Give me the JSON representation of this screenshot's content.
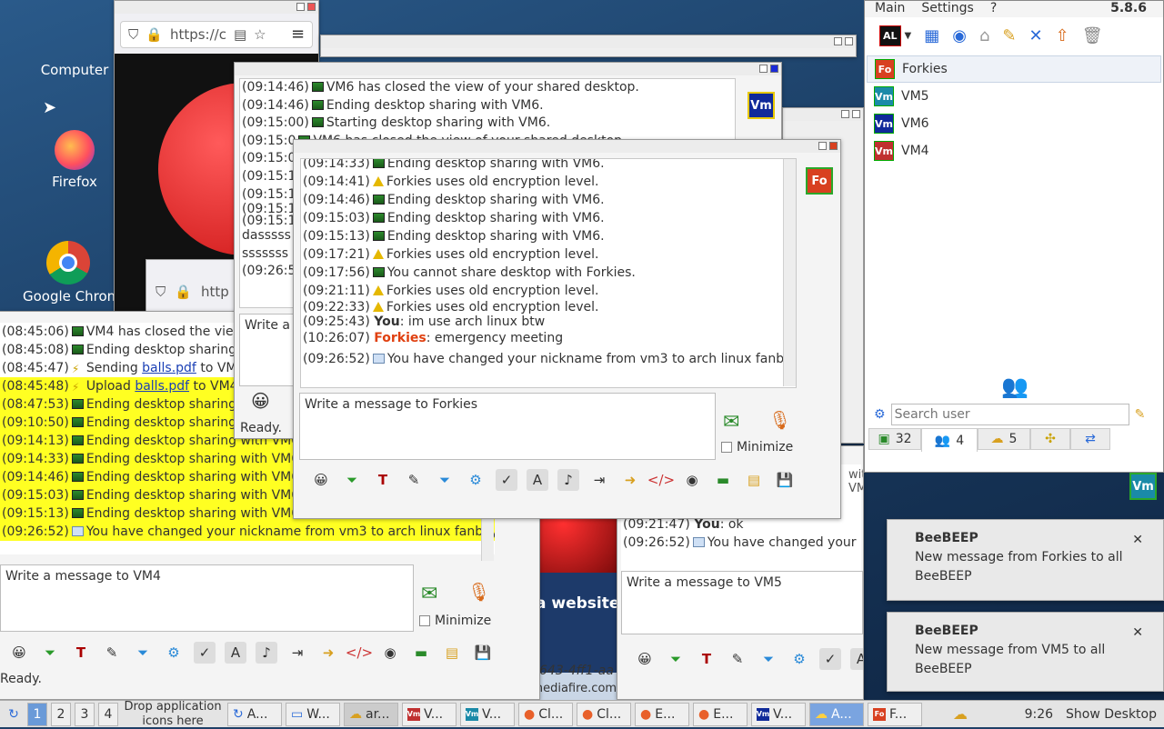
{
  "desktop": {
    "icons": [
      {
        "label": "Computer"
      },
      {
        "label": "Firefox"
      },
      {
        "label": "Google Chrome"
      }
    ]
  },
  "browser": {
    "url": "https://c",
    "url2": "http"
  },
  "vm4": {
    "log": [
      {
        "ts": "(08:45:06)",
        "icon": "sh",
        "text": "VM4 has closed the view"
      },
      {
        "ts": "(08:45:08)",
        "icon": "sh",
        "text": "Ending desktop sharing"
      },
      {
        "ts": "(08:45:47)",
        "icon": "up",
        "pre": "Sending ",
        "link": "balls.pdf",
        "text": " to VM4"
      },
      {
        "ts": "(08:45:48)",
        "icon": "up",
        "pre": "Upload ",
        "link": "balls.pdf",
        "text": " to VM4:",
        "hl": true
      },
      {
        "ts": "(08:47:53)",
        "icon": "sh",
        "text": "Ending desktop sharing",
        "hl": true
      },
      {
        "ts": "(09:10:50)",
        "icon": "sh",
        "text": "Ending desktop sharing",
        "hl": true
      },
      {
        "ts": "(09:14:13)",
        "icon": "sh",
        "text": "Ending desktop sharing with VM6.",
        "hl": true
      },
      {
        "ts": "(09:14:33)",
        "icon": "sh",
        "text": "Ending desktop sharing with VM6.",
        "hl": true
      },
      {
        "ts": "(09:14:46)",
        "icon": "sh",
        "text": "Ending desktop sharing with VM6.",
        "hl": true
      },
      {
        "ts": "(09:15:03)",
        "icon": "sh",
        "text": "Ending desktop sharing with VM6.",
        "hl": true
      },
      {
        "ts": "(09:15:13)",
        "icon": "sh",
        "text": "Ending desktop sharing with VM6.",
        "hl": true
      },
      {
        "ts": "(09:26:52)",
        "icon": "sy",
        "text": "You have changed your nickname from vm3 to arch linux fanboy.",
        "hl": true
      }
    ],
    "compose": "Write a message to VM4",
    "minimize": "Minimize",
    "status": "Ready."
  },
  "vm6": {
    "log": [
      {
        "ts": "(09:14:46)",
        "icon": "sh",
        "text": "VM6 has closed the view of your shared desktop."
      },
      {
        "ts": "(09:14:46)",
        "icon": "sh",
        "text": "Ending desktop sharing with VM6."
      },
      {
        "ts": "(09:15:00)",
        "icon": "sh",
        "text": "Starting desktop sharing with VM6."
      },
      {
        "ts": "(09:15:0",
        "icon": "sh",
        "text": "VM6 has closed the view of your shared desktop."
      },
      {
        "ts": "(09:15:0",
        "icon": "",
        "text": ""
      },
      {
        "ts": "(09:15:1",
        "icon": "",
        "text": ""
      },
      {
        "ts": "(09:15:1",
        "icon": "",
        "text": ""
      },
      {
        "ts": "(09:15:1",
        "icon": "",
        "text": ""
      },
      {
        "ts": "(09:15:1",
        "icon": "",
        "text": ""
      },
      {
        "ts": "dasssss",
        "icon": "",
        "text": ""
      },
      {
        "ts": "sssssss",
        "icon": "",
        "text": ""
      },
      {
        "ts": "(09:26:5",
        "icon": "",
        "text": ""
      }
    ],
    "compose": "Write a m",
    "status": "Ready.",
    "avatar": "Vm"
  },
  "forkies": {
    "log": [
      {
        "ts": "(09:14:33)",
        "icon": "sh",
        "text": "Ending desktop sharing with VM6."
      },
      {
        "ts": "(09:14:41)",
        "icon": "wn",
        "text": "Forkies uses old encryption level."
      },
      {
        "ts": "(09:14:46)",
        "icon": "sh",
        "text": "Ending desktop sharing with VM6."
      },
      {
        "ts": "(09:15:03)",
        "icon": "sh",
        "text": "Ending desktop sharing with VM6."
      },
      {
        "ts": "(09:15:13)",
        "icon": "sh",
        "text": "Ending desktop sharing with VM6."
      },
      {
        "ts": "(09:17:21)",
        "icon": "wn",
        "text": "Forkies uses old encryption level."
      },
      {
        "ts": "(09:17:56)",
        "icon": "sh",
        "text": "You cannot share desktop with Forkies."
      },
      {
        "ts": "(09:21:11)",
        "icon": "wn",
        "text": "Forkies uses old encryption level."
      },
      {
        "ts": "(09:22:33)",
        "icon": "wn",
        "text": "Forkies uses old encryption level."
      }
    ],
    "msg1": {
      "ts": "(09:25:43)",
      "who": "You",
      "text": ": im use arch linux btw"
    },
    "msg2": {
      "ts": "(10:26:07)",
      "who": "Forkies",
      "text": ": emergency meeting"
    },
    "sys": {
      "ts": "(09:26:52)",
      "text": "You have changed your nickname from vm3 to arch linux fanboy."
    },
    "compose": "Write a message to Forkies",
    "minimize": "Minimize",
    "avatar": "Fo"
  },
  "vm5": {
    "log1": {
      "ts": "(09:21:47)",
      "who": "You",
      "text": ": ok"
    },
    "log2": {
      "ts": "(09:26:52)",
      "text": "You have changed your nickn"
    },
    "partial": "with VM6.",
    "compose": "Write a message to VM5",
    "avatar": "Vm"
  },
  "web": {
    "heading": "a website",
    "url": "643-4ff1-aa",
    "url2": "https://www.mediafire.com%2"
  },
  "beebeep": {
    "menu": [
      "Main",
      "Settings",
      "?"
    ],
    "version": "5.8.6",
    "al": "AL",
    "users": [
      {
        "name": "Forkies",
        "av": "Fo",
        "color": "#d84020"
      },
      {
        "name": "VM5",
        "av": "Vm",
        "color": "#1a8aa8"
      },
      {
        "name": "VM6",
        "av": "Vm",
        "color": "#102a9a"
      },
      {
        "name": "VM4",
        "av": "Vm",
        "color": "#c03030"
      }
    ],
    "search_placeholder": "Search user",
    "tabs": [
      {
        "count": "32"
      },
      {
        "count": "4"
      },
      {
        "count": "5"
      },
      {
        "count": ""
      },
      {
        "count": ""
      }
    ]
  },
  "notifications": [
    {
      "title": "BeeBEEP",
      "body": "New message from Forkies to all BeeBEEP"
    },
    {
      "title": "BeeBEEP",
      "body": "New message from VM5 to all BeeBEEP"
    }
  ],
  "taskbar": {
    "workspaces": [
      "1",
      "2",
      "3",
      "4"
    ],
    "drop": "Drop application icons here",
    "tasks": [
      "A...",
      "W...",
      "ar...",
      "V...",
      "V...",
      "Cl...",
      "Cl...",
      "E...",
      "E...",
      "V...",
      "A...",
      "F..."
    ],
    "clock": "9:26",
    "show_desktop": "Show Desktop"
  }
}
